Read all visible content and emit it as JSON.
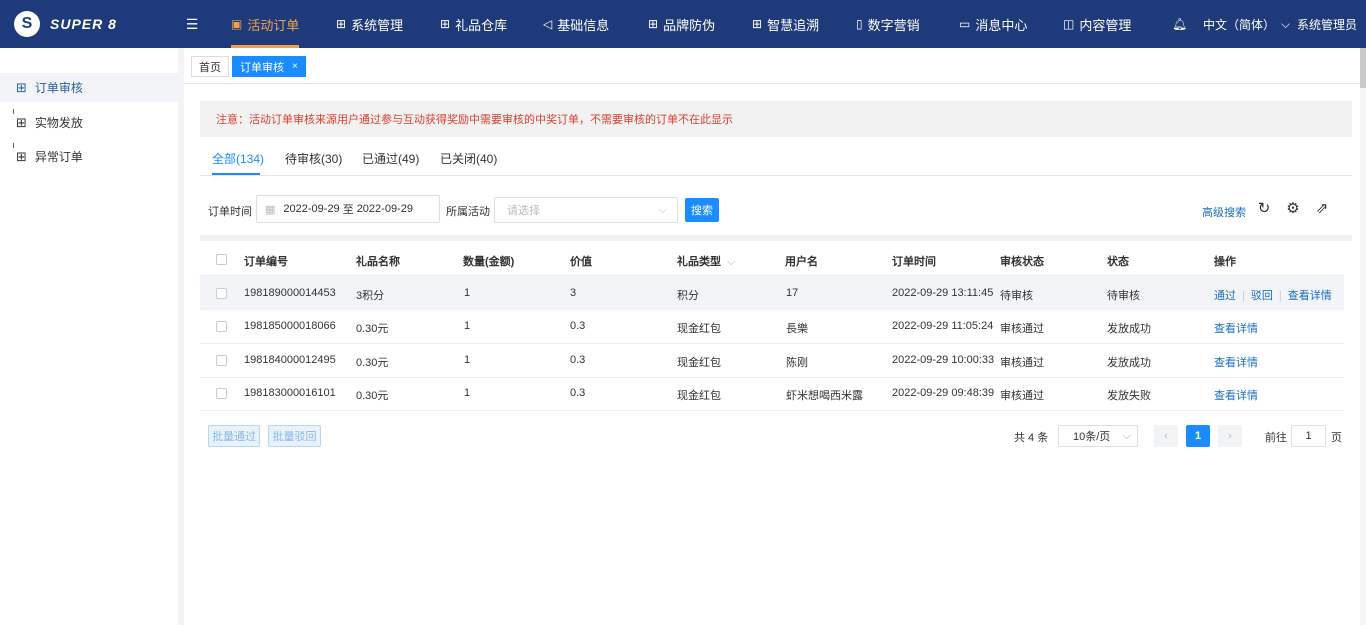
{
  "app": {
    "logo_mark": "S",
    "logo_text": "SUPER 8"
  },
  "nav": {
    "menu_toggle_icon": "menu-fold-icon",
    "items": [
      {
        "label": "活动订单",
        "icon": "order-icon",
        "active": true
      },
      {
        "label": "系统管理",
        "icon": "apps-icon"
      },
      {
        "label": "礼品仓库",
        "icon": "apps-icon"
      },
      {
        "label": "基础信息",
        "icon": "speaker-icon"
      },
      {
        "label": "品牌防伪",
        "icon": "apps-icon"
      },
      {
        "label": "智慧追溯",
        "icon": "apps-icon"
      },
      {
        "label": "数字营销",
        "icon": "phone-icon"
      },
      {
        "label": "消息中心",
        "icon": "image-icon"
      },
      {
        "label": "内容管理",
        "icon": "book-icon"
      }
    ],
    "language": "中文（简体）",
    "user": "系统管理员"
  },
  "sidebar": {
    "items": [
      {
        "label": "订单审核",
        "active": true
      },
      {
        "label": "实物发放"
      },
      {
        "label": "异常订单"
      }
    ]
  },
  "page_tabs": [
    {
      "label": "首页"
    },
    {
      "label": "订单审核",
      "active": true,
      "close": "×"
    }
  ],
  "notice": "注意：活动订单审核来源用户通过参与互动获得奖励中需要审核的中奖订单，不需要审核的订单不在此显示",
  "status_tabs": [
    {
      "label": "全部(134)",
      "active": true
    },
    {
      "label": "待审核(30)"
    },
    {
      "label": "已通过(49)"
    },
    {
      "label": "已关闭(40)"
    }
  ],
  "filters": {
    "order_time_label": "订单时间",
    "date_start": "2022-09-29",
    "date_sep": "至",
    "date_end": "2022-09-29",
    "activity_label": "所属活动",
    "activity_placeholder": "请选择",
    "search_label": "搜索",
    "advanced_label": "高级搜索"
  },
  "table": {
    "columns": [
      "订单编号",
      "礼品名称",
      "数量(金额)",
      "价值",
      "礼品类型",
      "用户名",
      "订单时间",
      "审核状态",
      "状态",
      "操作"
    ],
    "rows": [
      {
        "id": "198189000014453",
        "gift": "3积分",
        "qty": "1",
        "value": "3",
        "type": "积分",
        "user": "17",
        "time": "2022-09-29 13:11:45",
        "audit": "待审核",
        "status": "待审核",
        "actions": [
          "通过",
          "驳回",
          "查看详情"
        ]
      },
      {
        "id": "198185000018066",
        "gift": "0.30元",
        "qty": "1",
        "value": "0.3",
        "type": "现金红包",
        "user": "長樂",
        "time": "2022-09-29 11:05:24",
        "audit": "审核通过",
        "status": "发放成功",
        "actions": [
          "查看详情"
        ]
      },
      {
        "id": "198184000012495",
        "gift": "0.30元",
        "qty": "1",
        "value": "0.3",
        "type": "现金红包",
        "user": "陈刚",
        "time": "2022-09-29 10:00:33",
        "audit": "审核通过",
        "status": "发放成功",
        "actions": [
          "查看详情"
        ]
      },
      {
        "id": "198183000016101",
        "gift": "0.30元",
        "qty": "1",
        "value": "0.3",
        "type": "现金红包",
        "user": "虾米想喝西米露",
        "time": "2022-09-29 09:48:39",
        "audit": "审核通过",
        "status": "发放失败",
        "actions": [
          "查看详情"
        ]
      }
    ]
  },
  "batch": {
    "approve": "批量通过",
    "reject": "批量驳回"
  },
  "pagination": {
    "total": "共 4 条",
    "page_size": "10条/页",
    "current": "1",
    "goto_prefix": "前往",
    "goto_value": "1",
    "goto_suffix": "页"
  },
  "colors": {
    "nav_bg": "#1f3a7a",
    "accent": "#1a8cff",
    "active_nav": "#f2a14a",
    "notice": "#e03e2d"
  }
}
